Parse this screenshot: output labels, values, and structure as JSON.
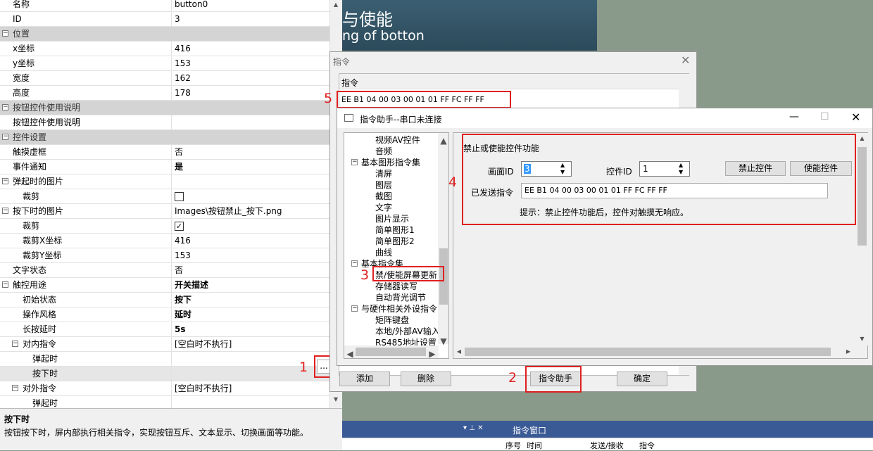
{
  "banner": {
    "line1": "与使能",
    "line2": "ng of botton"
  },
  "properties": {
    "rows": [
      {
        "name": "名称",
        "value": "button0",
        "type": "row"
      },
      {
        "name": "ID",
        "value": "3",
        "type": "row"
      },
      {
        "name": "位置",
        "value": "",
        "type": "category"
      },
      {
        "name": "x坐标",
        "value": "416",
        "type": "row"
      },
      {
        "name": "y坐标",
        "value": "153",
        "type": "row"
      },
      {
        "name": "宽度",
        "value": "162",
        "type": "row"
      },
      {
        "name": "高度",
        "value": "178",
        "type": "row"
      },
      {
        "name": "按钮控件使用说明",
        "value": "",
        "type": "category"
      },
      {
        "name": "按钮控件使用说明",
        "value": "",
        "type": "row"
      },
      {
        "name": "控件设置",
        "value": "",
        "type": "category"
      },
      {
        "name": "触摸虚框",
        "value": "否",
        "type": "row"
      },
      {
        "name": "事件通知",
        "value": "是",
        "type": "row",
        "bold": true
      },
      {
        "name": "弹起时的图片",
        "value": "",
        "type": "group"
      },
      {
        "name": "裁剪",
        "value": "",
        "type": "checkbox",
        "checked": false,
        "indent": 1
      },
      {
        "name": "按下时的图片",
        "value": "Images\\按钮禁止_按下.png",
        "type": "group"
      },
      {
        "name": "裁剪",
        "value": "",
        "type": "checkbox",
        "checked": true,
        "indent": 1
      },
      {
        "name": "裁剪X坐标",
        "value": "416",
        "type": "row",
        "indent": 1
      },
      {
        "name": "裁剪Y坐标",
        "value": "153",
        "type": "row",
        "indent": 1
      },
      {
        "name": "文字状态",
        "value": "否",
        "type": "row"
      },
      {
        "name": "触控用途",
        "value": "开关描述",
        "type": "group",
        "bold": true
      },
      {
        "name": "初始状态",
        "value": "按下",
        "type": "row",
        "indent": 1,
        "bold": true
      },
      {
        "name": "操作风格",
        "value": "延时",
        "type": "row",
        "indent": 1,
        "bold": true
      },
      {
        "name": "长按延时",
        "value": "5s",
        "type": "row",
        "indent": 1,
        "bold": true
      },
      {
        "name": "对内指令",
        "value": "[空白时不执行]",
        "type": "group",
        "indent": 1
      },
      {
        "name": "弹起时",
        "value": "",
        "type": "row",
        "indent": 2
      },
      {
        "name": "按下时",
        "value": "",
        "type": "row",
        "indent": 2,
        "selected": true
      },
      {
        "name": "对外指令",
        "value": "[空白时不执行]",
        "type": "group",
        "indent": 1
      },
      {
        "name": "弹起时",
        "value": "",
        "type": "row",
        "indent": 2
      }
    ],
    "ellipsis_label": "...",
    "help_title": "按下时",
    "help_text": "按钮按下时，屏内部执行相关指令，实现按钮互斥、文本显示、切换画面等功能。"
  },
  "cmd_dialog": {
    "title": "指令",
    "list_header": "指令",
    "command_value": "EE B1 04 00 03 00 01 01 FF FC FF FF",
    "add_label": "添加",
    "delete_label": "删除",
    "assistant_label": "指令助手",
    "ok_label": "确定"
  },
  "assistant": {
    "title": "指令助手--串口未连接",
    "tree": [
      {
        "label": "视频AV控件",
        "level": 2
      },
      {
        "label": "音频",
        "level": 2
      },
      {
        "label": "基本图形指令集",
        "level": 1,
        "expander": "⊟"
      },
      {
        "label": "清屏",
        "level": 2
      },
      {
        "label": "图层",
        "level": 2
      },
      {
        "label": "截图",
        "level": 2
      },
      {
        "label": "文字",
        "level": 2
      },
      {
        "label": "图片显示",
        "level": 2
      },
      {
        "label": "简单图形1",
        "level": 2
      },
      {
        "label": "简单图形2",
        "level": 2
      },
      {
        "label": "曲线",
        "level": 2
      },
      {
        "label": "基本指令集",
        "level": 1,
        "expander": "⊟"
      },
      {
        "label": "禁/使能屏幕更新",
        "level": 2,
        "selected": true
      },
      {
        "label": "存储器读写",
        "level": 2
      },
      {
        "label": "自动背光调节",
        "level": 2
      },
      {
        "label": "与硬件相关外设指令",
        "level": 1,
        "expander": "⊟"
      },
      {
        "label": "矩阵键盘",
        "level": 2
      },
      {
        "label": "本地/外部AV输入",
        "level": 2
      },
      {
        "label": "RS485地址设置",
        "level": 2
      }
    ],
    "group_title": "禁止或使能控件功能",
    "screen_id_label": "画面ID",
    "screen_id_value": "3",
    "control_id_label": "控件ID",
    "control_id_value": "1",
    "disable_label": "禁止控件",
    "enable_label": "使能控件",
    "sent_label": "已发送指令",
    "sent_value": "EE B1 04 00 03 00 01 01 FF FC FF FF",
    "hint": "提示：禁止控件功能后，控件对触摸无响应。"
  },
  "bottom": {
    "panel_title": "指令窗口",
    "col_seq": "序号",
    "col_time": "时间",
    "col_send": "发送/接收",
    "col_cmd": "指令"
  },
  "annotations": [
    "1",
    "2",
    "3",
    "4",
    "5"
  ],
  "colors": {
    "highlight": "#e02020",
    "banner": "#345566",
    "bottombar": "#3a5a96"
  }
}
